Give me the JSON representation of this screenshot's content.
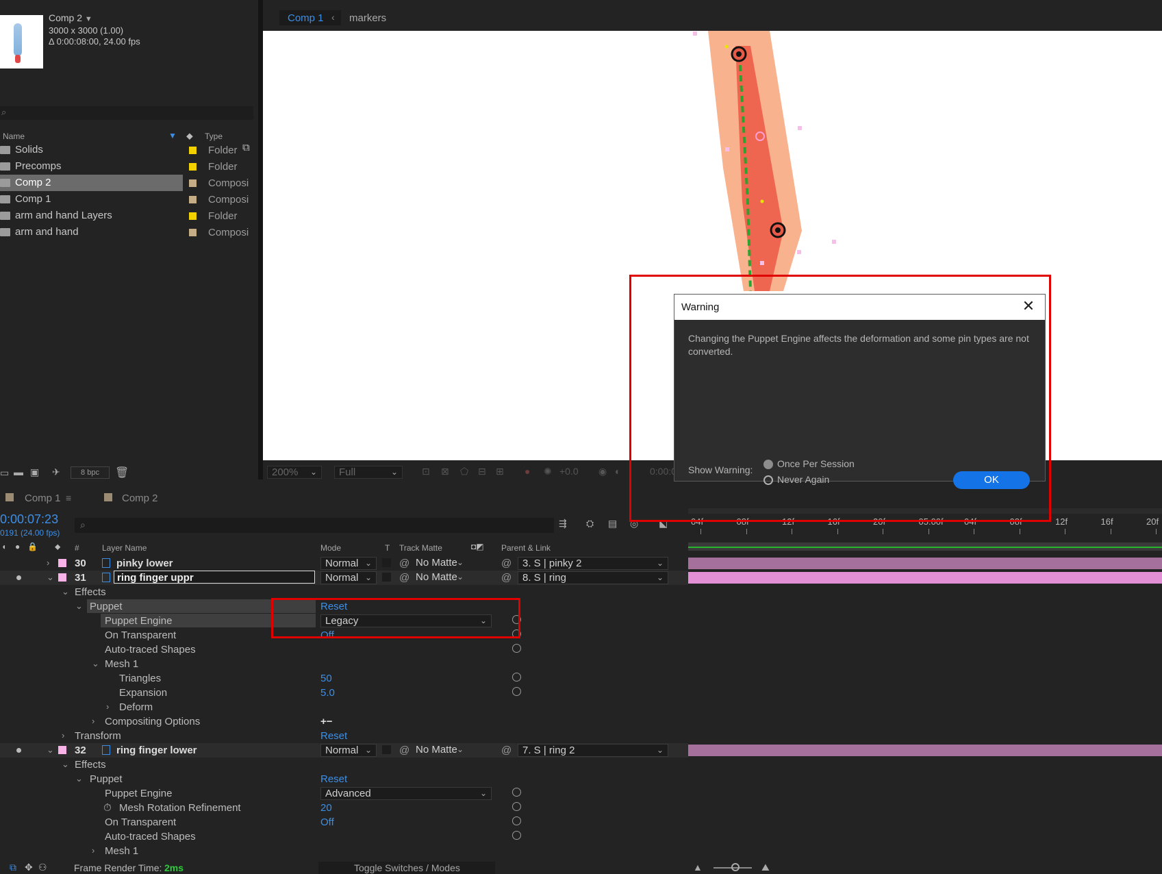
{
  "project": {
    "comp_name": "Comp 2",
    "comp_size": "3000 x 3000 (1.00)",
    "comp_duration": "Δ 0:00:08:00, 24.00 fps",
    "columns": {
      "name": "Name",
      "type": "Type"
    },
    "items": [
      {
        "name": "Solids",
        "type": "Folder",
        "color": "#f2d100",
        "icon": "folder-icon"
      },
      {
        "name": "Precomps",
        "type": "Folder",
        "color": "#f2d100",
        "icon": "folder-icon"
      },
      {
        "name": "Comp 2",
        "type": "Composi",
        "color": "#c7ad86",
        "icon": "composition-icon",
        "selected": true
      },
      {
        "name": "Comp 1",
        "type": "Composi",
        "color": "#c7ad86",
        "icon": "composition-icon"
      },
      {
        "name": "arm and hand Layers",
        "type": "Folder",
        "color": "#f2d100",
        "icon": "folder-icon"
      },
      {
        "name": "arm and hand",
        "type": "Composi",
        "color": "#c7ad86",
        "icon": "composition-icon"
      }
    ],
    "bpc": "8 bpc"
  },
  "viewer": {
    "breadcrumb": [
      "Comp 1",
      "markers"
    ],
    "zoom": "200%",
    "resolution": "Full",
    "exposure": "+0.0",
    "timecode_short": "0:00:0"
  },
  "timeline": {
    "tabs": [
      "Comp 1",
      "Comp 2"
    ],
    "timecode": "0:00:07:23",
    "frame_info": "0191 (24.00 fps)",
    "columns": {
      "num": "#",
      "layer_name": "Layer Name",
      "mode": "Mode",
      "t": "T",
      "track_matte": "Track Matte",
      "parent": "Parent & Link"
    },
    "ruler": [
      "04f",
      "08f",
      "12f",
      "16f",
      "20f",
      "05:00f",
      "04f",
      "08f",
      "12f",
      "16f",
      "20f"
    ],
    "layers": [
      {
        "num": "30",
        "name": "pinky lower",
        "mode": "Normal",
        "matte": "No Matte",
        "parent": "3. S | pinky 2",
        "label_color": "#f7b2e8"
      },
      {
        "num": "31",
        "name": "ring finger uppr",
        "mode": "Normal",
        "matte": "No Matte",
        "parent": "8. S | ring",
        "label_color": "#f7b2e8"
      },
      {
        "num": "32",
        "name": "ring finger lower",
        "mode": "Normal",
        "matte": "No Matte",
        "parent": "7. S | ring 2",
        "label_color": "#f7b2e8"
      }
    ],
    "props_31": {
      "effects": "Effects",
      "puppet": "Puppet",
      "reset": "Reset",
      "engine_label": "Puppet Engine",
      "engine_value": "Legacy",
      "on_transparent": "On Transparent",
      "on_transparent_value": "Off",
      "auto_traced": "Auto-traced Shapes",
      "mesh": "Mesh 1",
      "triangles": "Triangles",
      "triangles_value": "50",
      "expansion": "Expansion",
      "expansion_value": "5.0",
      "deform": "Deform",
      "compositing": "Compositing Options",
      "compositing_value": "+−",
      "transform": "Transform",
      "transform_reset": "Reset"
    },
    "props_32": {
      "effects": "Effects",
      "puppet": "Puppet",
      "reset": "Reset",
      "engine_label": "Puppet Engine",
      "engine_value": "Advanced",
      "mesh_rotation": "Mesh Rotation Refinement",
      "mesh_rotation_value": "20",
      "on_transparent": "On Transparent",
      "on_transparent_value": "Off",
      "auto_traced": "Auto-traced Shapes",
      "mesh": "Mesh 1"
    },
    "footer": {
      "render_label": "Frame Render Time:",
      "render_value": "2ms",
      "toggle": "Toggle Switches / Modes"
    }
  },
  "dialog": {
    "title": "Warning",
    "message": "Changing the Puppet Engine affects the deformation and some pin types are not converted.",
    "show_label": "Show Warning:",
    "options": [
      "Once Per Session",
      "Never Again"
    ],
    "selected_option": "Once Per Session",
    "ok": "OK"
  },
  "colors": {
    "accent_blue": "#3d8fe6",
    "ok_button": "#1473e6",
    "highlight_red": "#e10000"
  }
}
